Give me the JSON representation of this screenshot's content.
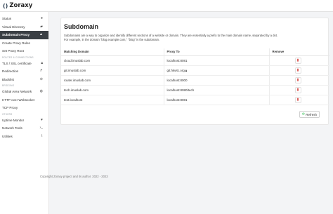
{
  "app": {
    "title": "Zoraxy",
    "logo": "()"
  },
  "sidebar": {
    "items": [
      {
        "label": "Status",
        "icon": "info-circle-icon"
      },
      {
        "label": "Virtual Directory",
        "icon": "folder-icon"
      },
      {
        "label": "Subdomain Proxy",
        "icon": "sitemap-icon",
        "active": true
      },
      {
        "label": "Create Proxy Rules",
        "icon": ""
      },
      {
        "label": "Set Proxy Root",
        "icon": ""
      }
    ],
    "section_access": "ROUTES & CONNECTIONS",
    "access_items": [
      {
        "label": "TLS / SSL certificate",
        "icon": "lock-icon"
      },
      {
        "label": "Redirection",
        "icon": "redirect-icon"
      },
      {
        "label": "Blacklist",
        "icon": "ban-icon"
      }
    ],
    "section_network": "BRIDGING",
    "network_items": [
      {
        "label": "Global Area Network",
        "icon": "globe-icon"
      },
      {
        "label": "HTTP over Websocket",
        "icon": ""
      },
      {
        "label": "TCP Proxy",
        "icon": ""
      }
    ],
    "section_others": "OTHERS",
    "other_items": [
      {
        "label": "Uptime Monitor",
        "icon": "heartbeat-icon"
      },
      {
        "label": "Network Tools",
        "icon": "terminal-icon"
      },
      {
        "label": "Utilities",
        "icon": "paperclip-icon"
      }
    ]
  },
  "main": {
    "title": "Subdomain",
    "description_line1": "Subdomains are a way to organize and identify different sections of a website or domain. They are essentially a prefix to the main domain name, separated by a dot.",
    "description_line2": "For example, in the domain \"blog.example.com,\" \"blog\" is the subdomain.",
    "table": {
      "headers": [
        "Matching Domain",
        "Proxy To",
        "Remove"
      ],
      "rows": [
        {
          "domain": "cloud.imuslab.com",
          "proxy": "localhost:8081",
          "lock": false
        },
        {
          "domain": "git.imuslab.com",
          "proxy": "git.hkwtc.org",
          "lock": true
        },
        {
          "domain": "router.imuslab.com",
          "proxy": "localhost:8000",
          "lock": false
        },
        {
          "domain": "tech.imuslab.com",
          "proxy": "localhost:8080/tech",
          "lock": false
        },
        {
          "domain": "test.localhost",
          "proxy": "localhost:8081",
          "lock": false
        }
      ]
    },
    "refresh_label": "Refresh"
  },
  "footer": {
    "text": "Copyright Zoraxy project and its author. 2022 - 2023"
  },
  "colors": {
    "active_nav": "#3a3f44",
    "remove_icon": "#d9534f",
    "refresh_icon": "#21ba45"
  }
}
